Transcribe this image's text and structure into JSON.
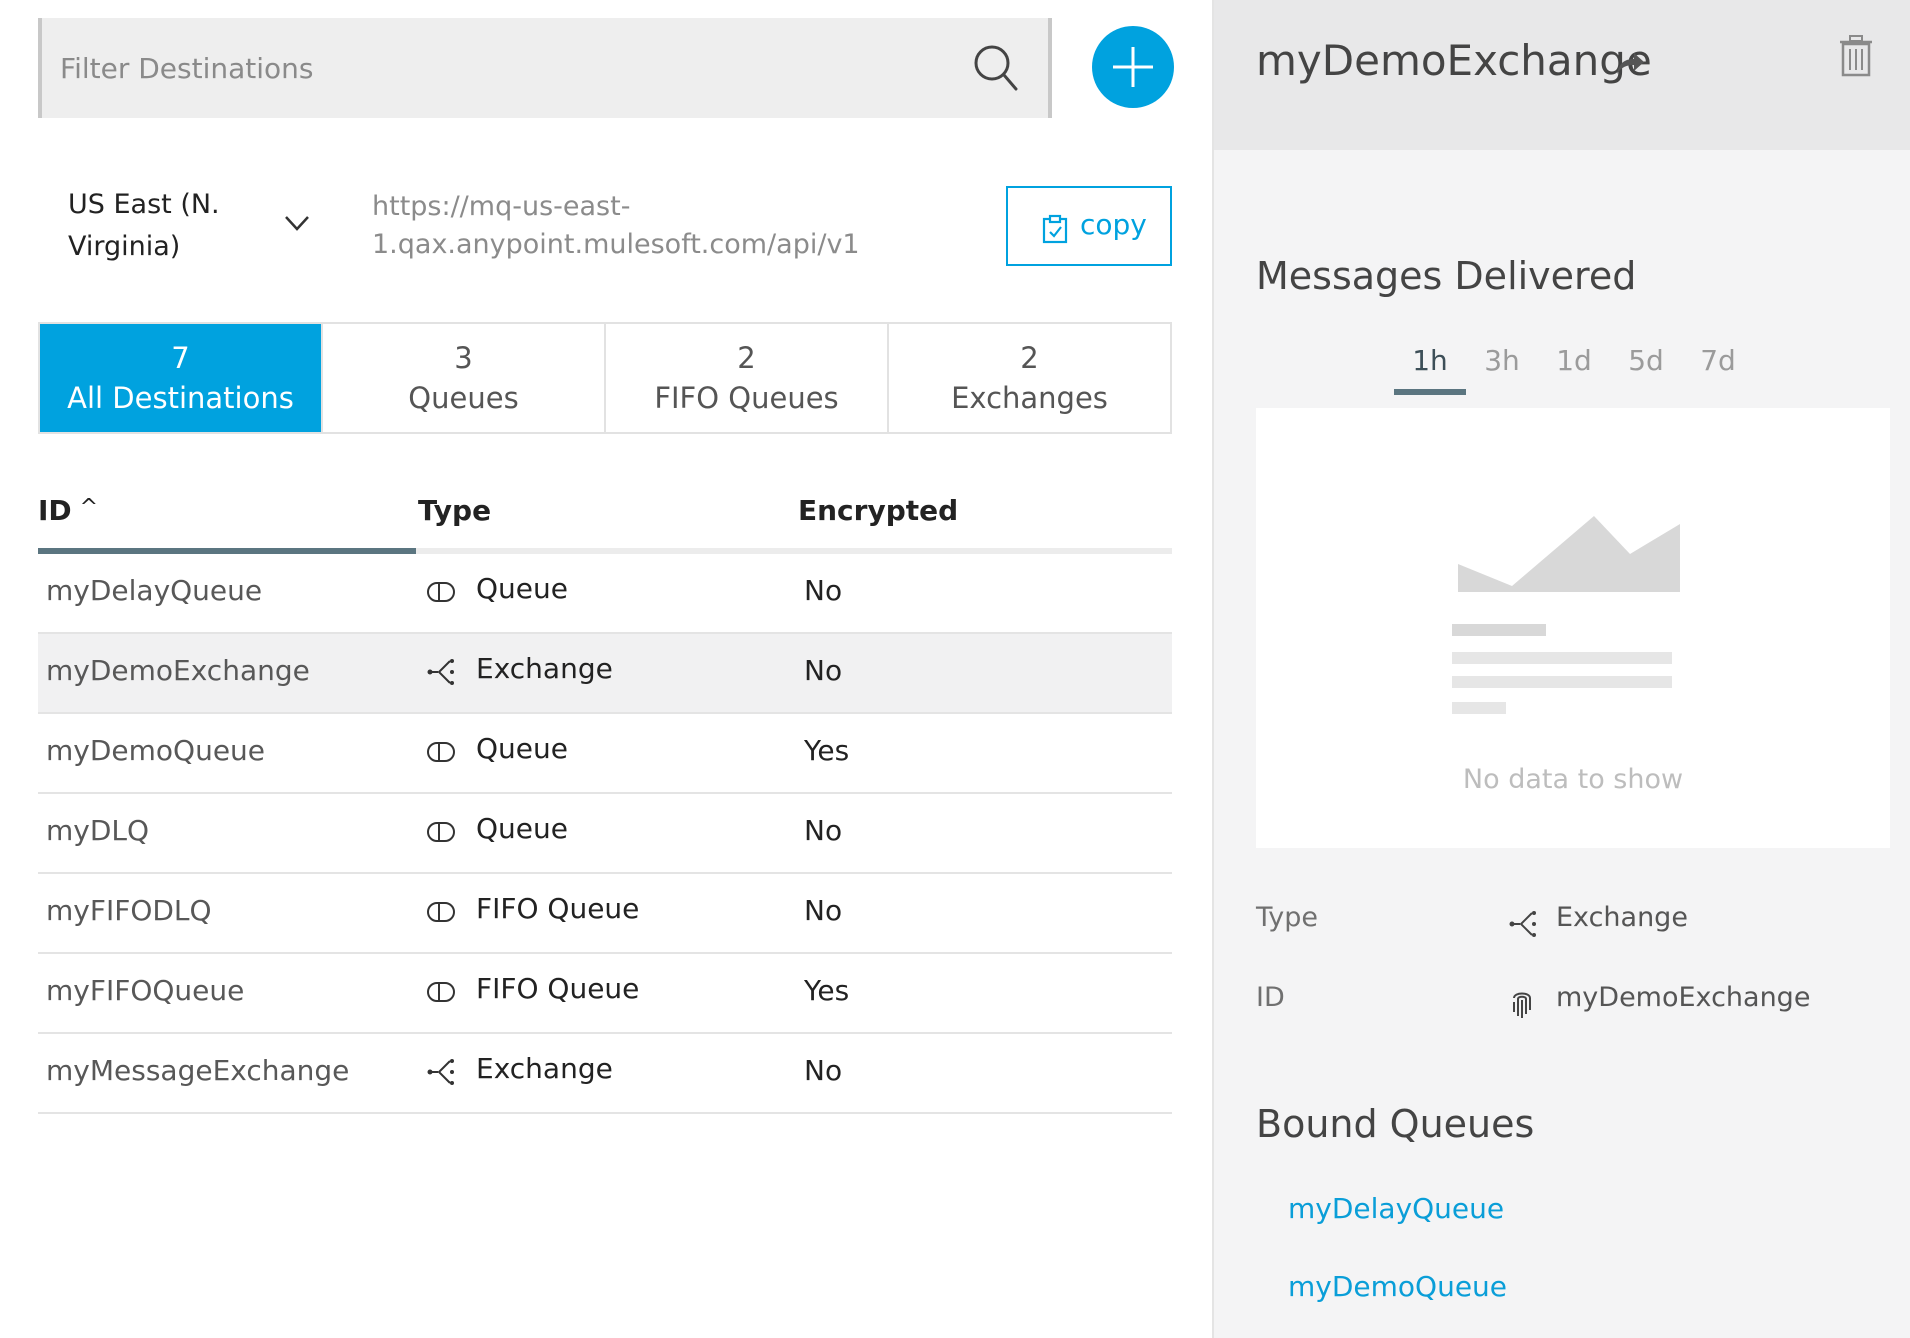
{
  "filter": {
    "placeholder": "Filter Destinations"
  },
  "region": {
    "label": "US East (N. Virginia)"
  },
  "endpoint": {
    "url": "https://mq-us-east-1.qax.anypoint.mulesoft.com/api/v1",
    "copy_label": "copy"
  },
  "tabs": [
    {
      "count": "7",
      "label": "All Destinations",
      "active": true
    },
    {
      "count": "3",
      "label": "Queues"
    },
    {
      "count": "2",
      "label": "FIFO Queues"
    },
    {
      "count": "2",
      "label": "Exchanges"
    }
  ],
  "table": {
    "headers": {
      "id": "ID",
      "id_sort": "^",
      "type": "Type",
      "encrypted": "Encrypted"
    },
    "rows": [
      {
        "id": "myDelayQueue",
        "type": "Queue",
        "icon": "queue-icon",
        "encrypted": "No"
      },
      {
        "id": "myDemoExchange",
        "type": "Exchange",
        "icon": "exchange-icon",
        "encrypted": "No",
        "selected": true
      },
      {
        "id": "myDemoQueue",
        "type": "Queue",
        "icon": "queue-icon",
        "encrypted": "Yes"
      },
      {
        "id": "myDLQ",
        "type": "Queue",
        "icon": "queue-icon",
        "encrypted": "No"
      },
      {
        "id": "myFIFODLQ",
        "type": "FIFO Queue",
        "icon": "queue-icon",
        "encrypted": "No"
      },
      {
        "id": "myFIFOQueue",
        "type": "FIFO Queue",
        "icon": "queue-icon",
        "encrypted": "Yes"
      },
      {
        "id": "myMessageExchange",
        "type": "Exchange",
        "icon": "exchange-icon",
        "encrypted": "No"
      }
    ]
  },
  "detail": {
    "title": "myDemoExchange",
    "messages_title": "Messages Delivered",
    "ranges": [
      "1h",
      "3h",
      "1d",
      "5d",
      "7d"
    ],
    "active_range": "1h",
    "empty_text": "No data to show",
    "type_label": "Type",
    "type_value": "Exchange",
    "id_label": "ID",
    "id_value": "myDemoExchange",
    "bound_title": "Bound Queues",
    "bound_queues": [
      "myDelayQueue",
      "myDemoQueue"
    ]
  },
  "colors": {
    "accent": "#00a2df",
    "sort_bar": "#5b7580",
    "link": "#0a9ed8"
  }
}
